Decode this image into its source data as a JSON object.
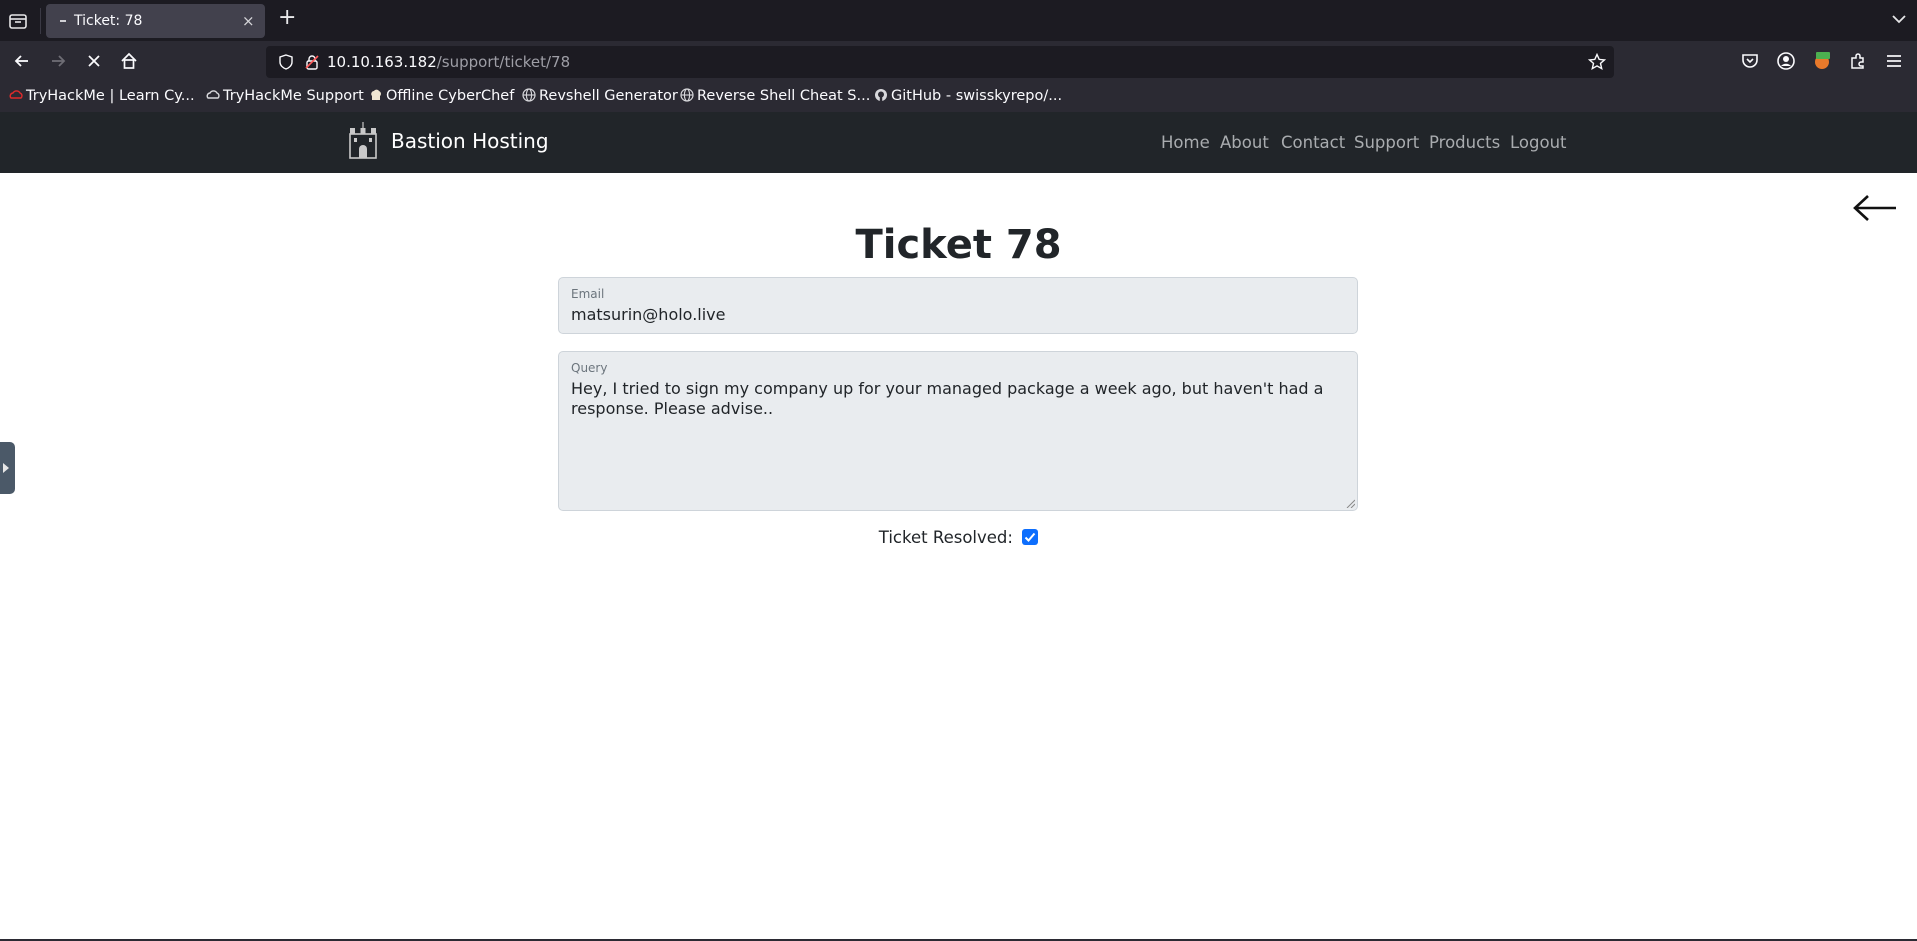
{
  "browser": {
    "tab_title": "Ticket: 78",
    "tab_close": "×",
    "new_tab": "+",
    "url_host": "10.10.163.182",
    "url_path": "/support/ticket/78",
    "bookmarks": [
      {
        "label": "TryHackMe | Learn Cy...",
        "icon": "tryhackme-icon"
      },
      {
        "label": "TryHackMe Support",
        "icon": "cloud-icon"
      },
      {
        "label": "Offline CyberChef",
        "icon": "chef-hat-icon"
      },
      {
        "label": "Revshell Generator",
        "icon": "globe-icon"
      },
      {
        "label": "Reverse Shell Cheat S...",
        "icon": "globe-icon"
      },
      {
        "label": "GitHub - swisskyrepo/...",
        "icon": "github-icon"
      }
    ]
  },
  "site": {
    "brand": "Bastion Hosting",
    "menu": [
      "Home",
      "About",
      "Contact",
      "Support",
      "Products",
      "Logout"
    ]
  },
  "ticket": {
    "title": "Ticket 78",
    "email_label": "Email",
    "email_value": "matsurin@holo.live",
    "query_label": "Query",
    "query_value": "Hey, I tried to sign my company up for your managed package a week ago, but haven't had a response. Please advise..",
    "resolved_label": "Ticket Resolved:",
    "resolved": true
  },
  "colors": {
    "site_nav_bg": "#212529",
    "field_bg": "#e9ecef",
    "checkbox_accent": "#0d6efd"
  }
}
